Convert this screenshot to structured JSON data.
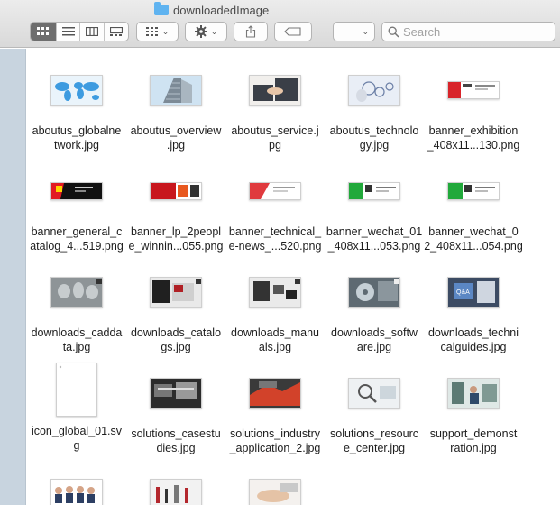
{
  "window": {
    "title": "downloadedImage"
  },
  "toolbar": {
    "view_modes": [
      "icon-view",
      "list-view",
      "column-view",
      "gallery-view"
    ],
    "selected_view": "icon-view",
    "group_icon": "group-grid-icon",
    "action_icon": "gear-icon",
    "share_icon": "share-icon",
    "tag_icon": "tag-icon",
    "path_dropdown": ""
  },
  "search": {
    "placeholder": "Search"
  },
  "files": [
    {
      "name": "aboutus_globalnetwork.jpg",
      "label_line1": "aboutus_globalne",
      "label_line2": "twork.jpg",
      "thumb": "world-map"
    },
    {
      "name": "aboutus_overview.jpg",
      "label_line1": "aboutus_overview",
      "label_line2": ".jpg",
      "thumb": "building"
    },
    {
      "name": "aboutus_service.jpg",
      "label_line1": "aboutus_service.j",
      "label_line2": "pg",
      "thumb": "handshake"
    },
    {
      "name": "aboutus_technology.jpg",
      "label_line1": "aboutus_technolo",
      "label_line2": "gy.jpg",
      "thumb": "gears"
    },
    {
      "name": "banner_exhibition_408x11...130.png",
      "label_line1": "banner_exhibition",
      "label_line2": "_408x11...130.png",
      "thumb": "banner-red"
    },
    {
      "name": "banner_general_catalog_4...519.png",
      "label_line1": "banner_general_c",
      "label_line2": "atalog_4...519.png",
      "thumb": "banner-black-yellow"
    },
    {
      "name": "banner_lp_2people_winnin...055.png",
      "label_line1": "banner_lp_2peopl",
      "label_line2": "e_winnin...055.png",
      "thumb": "banner-red-white"
    },
    {
      "name": "banner_technical_e-news_...520.png",
      "label_line1": "banner_technical_",
      "label_line2": "e-news_...520.png",
      "thumb": "banner-white-red"
    },
    {
      "name": "banner_wechat_01_408x11...053.png",
      "label_line1": "banner_wechat_01",
      "label_line2": "_408x11...053.png",
      "thumb": "banner-green"
    },
    {
      "name": "banner_wechat_02_408x11...054.png",
      "label_line1": "banner_wechat_0",
      "label_line2": "2_408x11...054.png",
      "thumb": "banner-green"
    },
    {
      "name": "downloads_caddata.jpg",
      "label_line1": "downloads_cadda",
      "label_line2": "ta.jpg",
      "thumb": "gray-parts"
    },
    {
      "name": "downloads_catalogs.jpg",
      "label_line1": "downloads_catalo",
      "label_line2": "gs.jpg",
      "thumb": "catalog"
    },
    {
      "name": "downloads_manuals.jpg",
      "label_line1": "downloads_manu",
      "label_line2": "als.jpg",
      "thumb": "manuals"
    },
    {
      "name": "downloads_software.jpg",
      "label_line1": "downloads_softw",
      "label_line2": "are.jpg",
      "thumb": "cd"
    },
    {
      "name": "downloads_technicalguides.jpg",
      "label_line1": "downloads_techni",
      "label_line2": "calguides.jpg",
      "thumb": "guides"
    },
    {
      "name": "icon_global_01.svg",
      "label_line1": "icon_global_01.sv",
      "label_line2": "g",
      "thumb": "blank-doc"
    },
    {
      "name": "solutions_casestudies.jpg",
      "label_line1": "solutions_casestu",
      "label_line2": "dies.jpg",
      "thumb": "machine-dark"
    },
    {
      "name": "solutions_industry_application_2.jpg",
      "label_line1": "solutions_industry",
      "label_line2": "_application_2.jpg",
      "thumb": "industry"
    },
    {
      "name": "solutions_resource_center.jpg",
      "label_line1": "solutions_resourc",
      "label_line2": "e_center.jpg",
      "thumb": "magnifier"
    },
    {
      "name": "support_demonstration.jpg",
      "label_line1": "support_demonst",
      "label_line2": "ration.jpg",
      "thumb": "people-demo"
    },
    {
      "name": "",
      "label_line1": "",
      "label_line2": "",
      "thumb": "team"
    },
    {
      "name": "",
      "label_line1": "",
      "label_line2": "",
      "thumb": "tools"
    },
    {
      "name": "",
      "label_line1": "",
      "label_line2": "",
      "thumb": "hands"
    }
  ]
}
